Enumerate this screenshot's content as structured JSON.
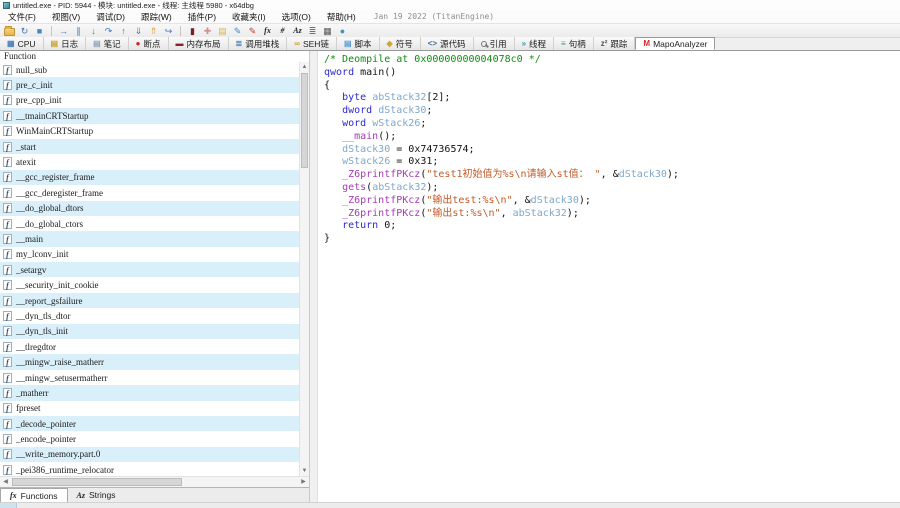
{
  "window": {
    "title": "untitled.exe - PID: 5944 - 模块: untitled.exe - 线程: 主线程 5980 - x64dbg"
  },
  "menubar": {
    "items": [
      "文件(F)",
      "视图(V)",
      "调试(D)",
      "跟踪(W)",
      "插件(P)",
      "收藏夹(I)",
      "选项(O)",
      "帮助(H)"
    ],
    "build_date": "Jan 19 2022 (TitanEngine)"
  },
  "toolbar": {
    "items": [
      {
        "name": "open-file-button",
        "icon": "folder"
      },
      {
        "name": "restart-button",
        "glyph": "↻",
        "color": "#3d78c0"
      },
      {
        "name": "stop-button",
        "glyph": "■",
        "color": "#4a84c4"
      },
      {
        "sep": true
      },
      {
        "name": "run-button",
        "glyph": "→",
        "color": "#3d78c0"
      },
      {
        "name": "pause-button",
        "glyph": "∥",
        "color": "#3d78c0"
      },
      {
        "name": "step-into-button",
        "glyph": "↓",
        "color": "#3d78c0"
      },
      {
        "name": "step-over-button",
        "glyph": "↷",
        "color": "#3d78c0"
      },
      {
        "name": "execute-till-return-button",
        "glyph": "↑",
        "color": "#3d78c0"
      },
      {
        "name": "step-out-button",
        "glyph": "⇓",
        "color": "#3d78c0"
      },
      {
        "name": "run-to-user-code-button",
        "glyph": "⇑",
        "color": "#e0a040"
      },
      {
        "name": "skip-next-button",
        "glyph": "↪",
        "color": "#3d78c0"
      },
      {
        "sep": true
      },
      {
        "name": "breakpoints-button",
        "glyph": "▮",
        "color": "#7a1f1f"
      },
      {
        "name": "patches-button",
        "glyph": "✚",
        "color": "#d09090"
      },
      {
        "name": "comments-button",
        "glyph": "▤",
        "color": "#d8b84a"
      },
      {
        "name": "edit-brush-button",
        "glyph": "✎",
        "color": "#4a86c8"
      },
      {
        "name": "highlight-pencil-button",
        "glyph": "✎",
        "color": "#c03a2a"
      },
      {
        "name": "assemble-fx-button",
        "glyph": "fx",
        "color": "#222222",
        "text": true
      },
      {
        "name": "label-hash-button",
        "glyph": "#",
        "color": "#222222",
        "text": true
      },
      {
        "name": "strings-az-button",
        "glyph": "Az",
        "color": "#222222",
        "text": true
      },
      {
        "name": "graph-button",
        "glyph": "≣",
        "color": "#3d78c0"
      },
      {
        "name": "memory-button",
        "glyph": "▦",
        "color": "#555555"
      },
      {
        "name": "settings-button",
        "glyph": "●",
        "color": "#3a9cb0"
      }
    ]
  },
  "tabbar": {
    "tabs": [
      {
        "name": "tab-cpu",
        "label": "CPU",
        "glyph": "▦",
        "color": "#4f81bd"
      },
      {
        "name": "tab-log",
        "label": "日志",
        "glyph": "▤",
        "color": "#c9a227"
      },
      {
        "name": "tab-notes",
        "label": "笔记",
        "glyph": "▤",
        "color": "#8fa3b8"
      },
      {
        "name": "tab-breakpoints",
        "label": "断点",
        "glyph": "●",
        "color": "#cc2222"
      },
      {
        "name": "tab-memory-map",
        "label": "内存布局",
        "glyph": "▬",
        "color": "#8b2525"
      },
      {
        "name": "tab-call-stack",
        "label": "调用堆栈",
        "glyph": "≣",
        "color": "#3a6ea5"
      },
      {
        "name": "tab-seh-chain",
        "label": "SEH链",
        "glyph": "∞",
        "color": "#c9a227"
      },
      {
        "name": "tab-script",
        "label": "脚本",
        "glyph": "▤",
        "color": "#5b9bd5"
      },
      {
        "name": "tab-symbols",
        "label": "符号",
        "glyph": "◈",
        "color": "#c9a227"
      },
      {
        "name": "tab-source",
        "label": "源代码",
        "glyph": "<>",
        "color": "#3a6ea5"
      },
      {
        "name": "tab-references",
        "label": "引用",
        "glyph": "mag"
      },
      {
        "name": "tab-threads",
        "label": "线程",
        "glyph": "»",
        "color": "#2a9caa"
      },
      {
        "name": "tab-handles",
        "label": "句柄",
        "glyph": "≡",
        "color": "#44a05c"
      },
      {
        "name": "tab-trace",
        "label": "跟踪",
        "glyph": "z²",
        "color": "#555555"
      },
      {
        "name": "tab-mapoanalyzer",
        "label": "MapoAnalyzer",
        "glyph": "M",
        "color": "#d42a2a",
        "active": true
      }
    ]
  },
  "functions_panel": {
    "header": "Function",
    "items": [
      "null_sub",
      "pre_c_init",
      "pre_cpp_init",
      "__tmainCRTStartup",
      "WinMainCRTStartup",
      "_start",
      "atexit",
      "__gcc_register_frame",
      "__gcc_deregister_frame",
      "__do_global_dtors",
      "__do_global_ctors",
      "__main",
      "my_lconv_init",
      "_setargv",
      "__security_init_cookie",
      "__report_gsfailure",
      "__dyn_tls_dtor",
      "__dyn_tls_init",
      "__tlregdtor",
      "__mingw_raise_matherr",
      "__mingw_setusermatherr",
      "_matherr",
      "fpreset",
      "_decode_pointer",
      "_encode_pointer",
      "__write_memory.part.0",
      "_pei386_runtime_relocator"
    ],
    "bottom_tabs": [
      {
        "name": "tab-functions",
        "icon": "fx",
        "label": "Functions",
        "active": true
      },
      {
        "name": "tab-strings",
        "icon": "Az",
        "label": "Strings",
        "active": false
      }
    ]
  },
  "code_panel": {
    "lines": [
      [
        [
          "com",
          "/* Deompile at 0x00000000004078c0 */"
        ]
      ],
      [
        [
          "kw",
          "qword"
        ],
        [
          "pl",
          " main()"
        ]
      ],
      [
        [
          "pl",
          "{"
        ]
      ],
      [
        [
          "pl",
          "   "
        ],
        [
          "kw",
          "byte"
        ],
        [
          "pl",
          " "
        ],
        [
          "var",
          "abStack32"
        ],
        [
          "pl",
          "[2];"
        ]
      ],
      [
        [
          "pl",
          "   "
        ],
        [
          "kw",
          "dword"
        ],
        [
          "pl",
          " "
        ],
        [
          "var",
          "dStack30"
        ],
        [
          "pl",
          ";"
        ]
      ],
      [
        [
          "pl",
          "   "
        ],
        [
          "kw",
          "word"
        ],
        [
          "pl",
          " "
        ],
        [
          "var",
          "wStack26"
        ],
        [
          "pl",
          ";"
        ]
      ],
      [
        [
          "pl",
          "   "
        ],
        [
          "fn",
          "__main"
        ],
        [
          "pl",
          "();"
        ]
      ],
      [
        [
          "pl",
          "   "
        ],
        [
          "var",
          "dStack30"
        ],
        [
          "pl",
          " = 0x74736574;"
        ]
      ],
      [
        [
          "pl",
          "   "
        ],
        [
          "var",
          "wStack26"
        ],
        [
          "pl",
          " = 0x31;"
        ]
      ],
      [
        [
          "pl",
          "   "
        ],
        [
          "fn",
          "_Z6printfPKcz"
        ],
        [
          "pl",
          "("
        ],
        [
          "str",
          "\"test1初始值为%s\\n请输入st值： \""
        ],
        [
          "pl",
          ", &"
        ],
        [
          "var",
          "dStack30"
        ],
        [
          "pl",
          ");"
        ]
      ],
      [
        [
          "pl",
          "   "
        ],
        [
          "fn",
          "gets"
        ],
        [
          "pl",
          "("
        ],
        [
          "var",
          "abStack32"
        ],
        [
          "pl",
          ");"
        ]
      ],
      [
        [
          "pl",
          "   "
        ],
        [
          "fn",
          "_Z6printfPKcz"
        ],
        [
          "pl",
          "("
        ],
        [
          "str",
          "\"输出test:%s\\n\""
        ],
        [
          "pl",
          ", &"
        ],
        [
          "var",
          "dStack30"
        ],
        [
          "pl",
          ");"
        ]
      ],
      [
        [
          "pl",
          "   "
        ],
        [
          "fn",
          "_Z6printfPKcz"
        ],
        [
          "pl",
          "("
        ],
        [
          "str",
          "\"输出st:%s\\n\""
        ],
        [
          "pl",
          ", "
        ],
        [
          "var",
          "abStack32"
        ],
        [
          "pl",
          ");"
        ]
      ],
      [
        [
          "pl",
          "   "
        ],
        [
          "kw",
          "return"
        ],
        [
          "pl",
          " 0;"
        ]
      ],
      [
        [
          "pl",
          "}"
        ]
      ]
    ]
  }
}
